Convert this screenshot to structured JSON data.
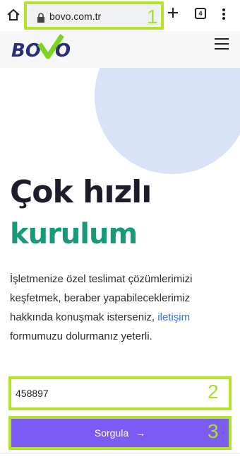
{
  "browser": {
    "url": "bovo.com.tr",
    "tab_count": "4",
    "annotations": [
      "1",
      "2",
      "3"
    ]
  },
  "site": {
    "logo_text": "BOVO",
    "colors": {
      "logo_primary": "#2b2d7a",
      "logo_check": "#7ed321",
      "accent_green": "#17997a",
      "button": "#7c5cf5",
      "blob": "#d9e3f7",
      "highlight": "#b4e32c",
      "link": "#3f6fd6"
    }
  },
  "hero": {
    "title_line1": "Çok hızlı",
    "title_line2": "kurulum",
    "desc_part1": "İşletmenize özel teslimat çözümlerimizi keşfetmek, beraber yapabileceklerimiz hakkında konuşmak isterseniz,",
    "desc_link": "iletişim",
    "desc_part2": "formumuzu dolurmanız yeterli."
  },
  "form": {
    "input_value": "458897",
    "submit_label": "Sorgula",
    "submit_icon": "arrow-right-icon"
  },
  "icons": [
    "home-icon",
    "lock-icon",
    "plus-icon",
    "tabs-icon",
    "overflow-menu-icon",
    "hamburger-menu-icon",
    "arrow-right-icon"
  ]
}
